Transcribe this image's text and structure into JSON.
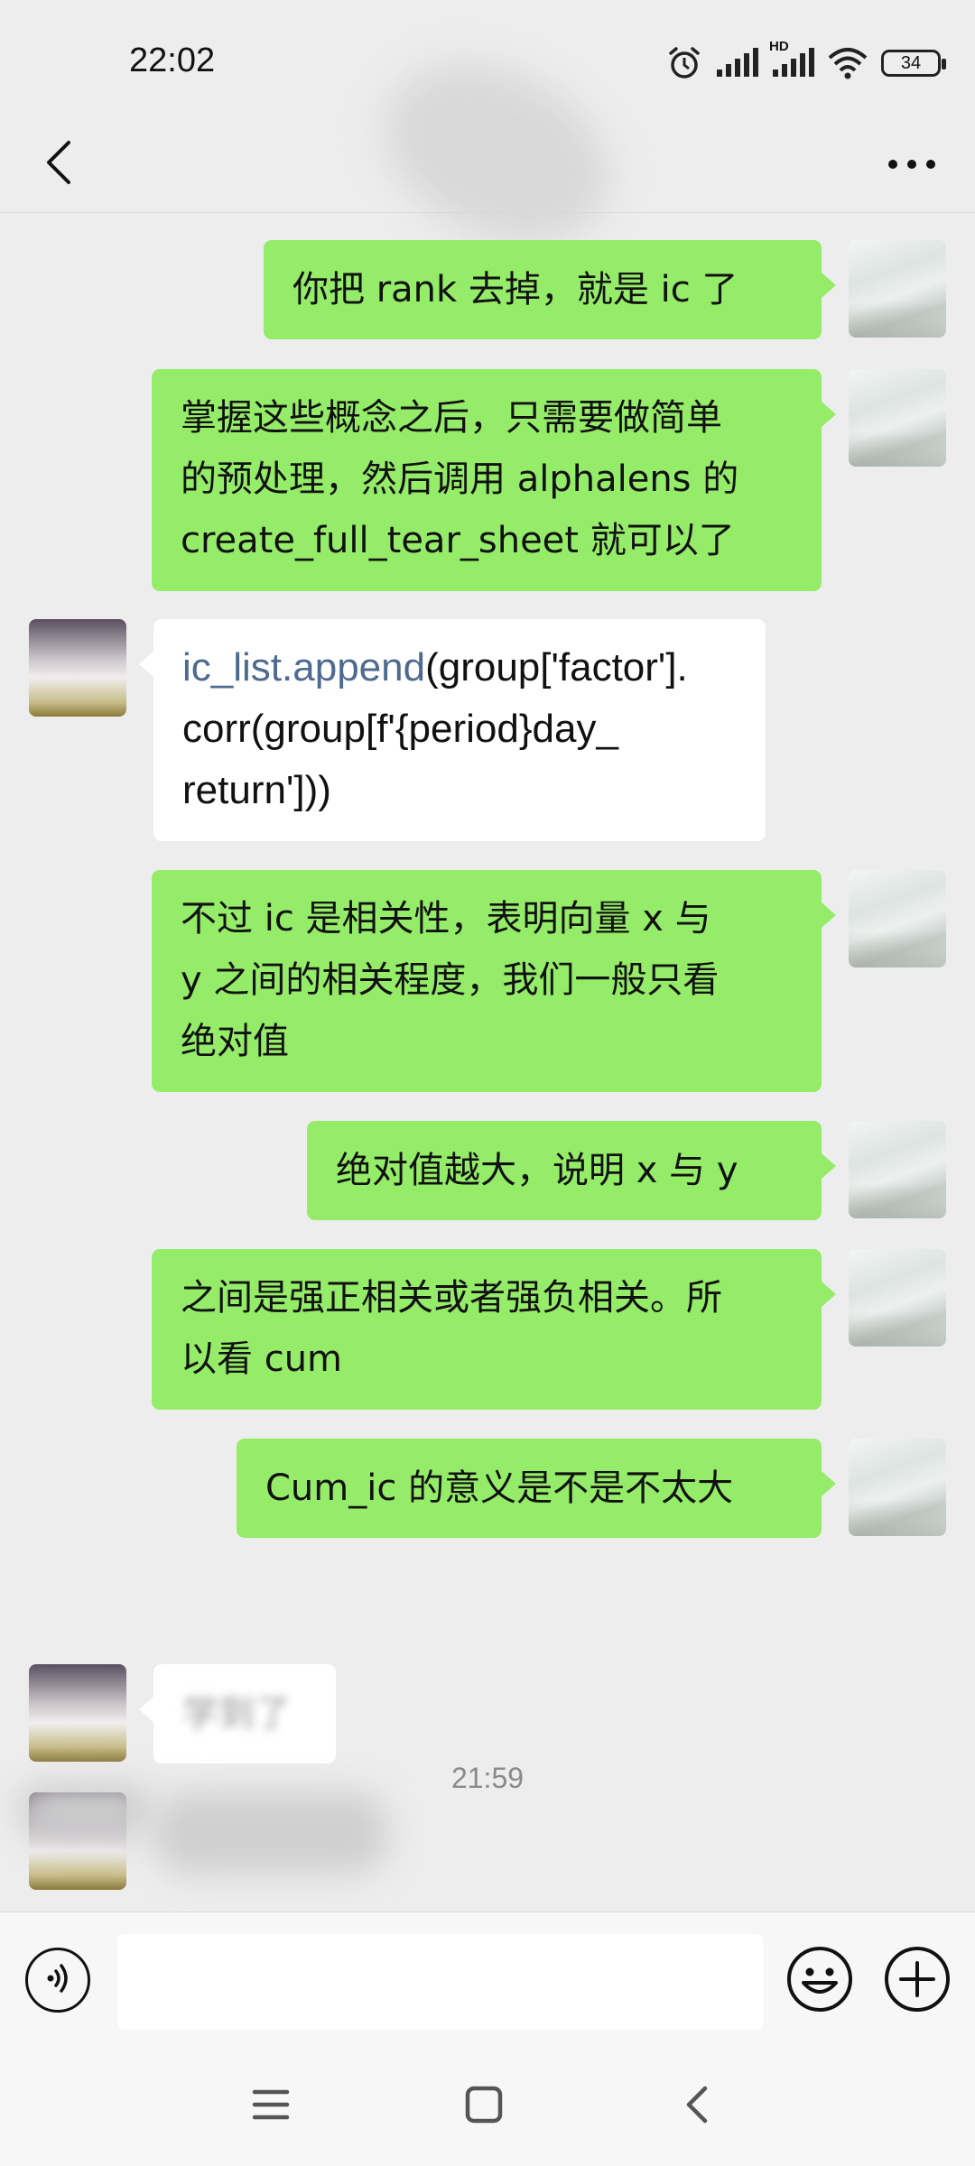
{
  "status_bar": {
    "time": "22:02",
    "network_label": "HD",
    "battery": "34"
  },
  "header": {
    "back_icon": "chevron-left-icon",
    "more_icon": "more-dots-icon"
  },
  "messages": [
    {
      "side": "me",
      "text": "你把 rank 去掉，就是 ic 了"
    },
    {
      "side": "me",
      "lines": [
        "掌握这些概念之后，只需要做简单",
        "的预处理，然后调用 alphalens 的",
        "create_full_tear_sheet 就可以了"
      ]
    },
    {
      "side": "other",
      "code_fn": "ic_list.append",
      "code_rest_1": "(group['factor'].",
      "code_line_2": "corr(group[f'{period}day_",
      "code_line_3": "return']))"
    },
    {
      "side": "me",
      "lines": [
        "不过 ic 是相关性，表明向量 x 与",
        "y 之间的相关程度，我们一般只看",
        "绝对值"
      ]
    },
    {
      "side": "me",
      "text": "绝对值越大，说明 x 与 y"
    },
    {
      "side": "me",
      "lines": [
        "之间是强正相关或者强负相关。所",
        "以看 cum"
      ]
    },
    {
      "side": "me",
      "text": "Cum_ic 的意义是不是不太大"
    },
    {
      "side": "other",
      "text": "学到了",
      "blurred": true
    }
  ],
  "timestamp": "21:59",
  "input_bar": {
    "voice_icon": "voice-icon",
    "emoji_icon": "emoji-icon",
    "plus_icon": "plus-icon",
    "value": ""
  },
  "nav_bar": {
    "menu_icon": "menu-icon",
    "home_icon": "home-icon",
    "back_icon": "back-icon"
  },
  "colors": {
    "background": "#EDEDED",
    "my_bubble": "#95EC69",
    "other_bubble": "#FFFFFF",
    "code_function": "#4F6A8F"
  }
}
